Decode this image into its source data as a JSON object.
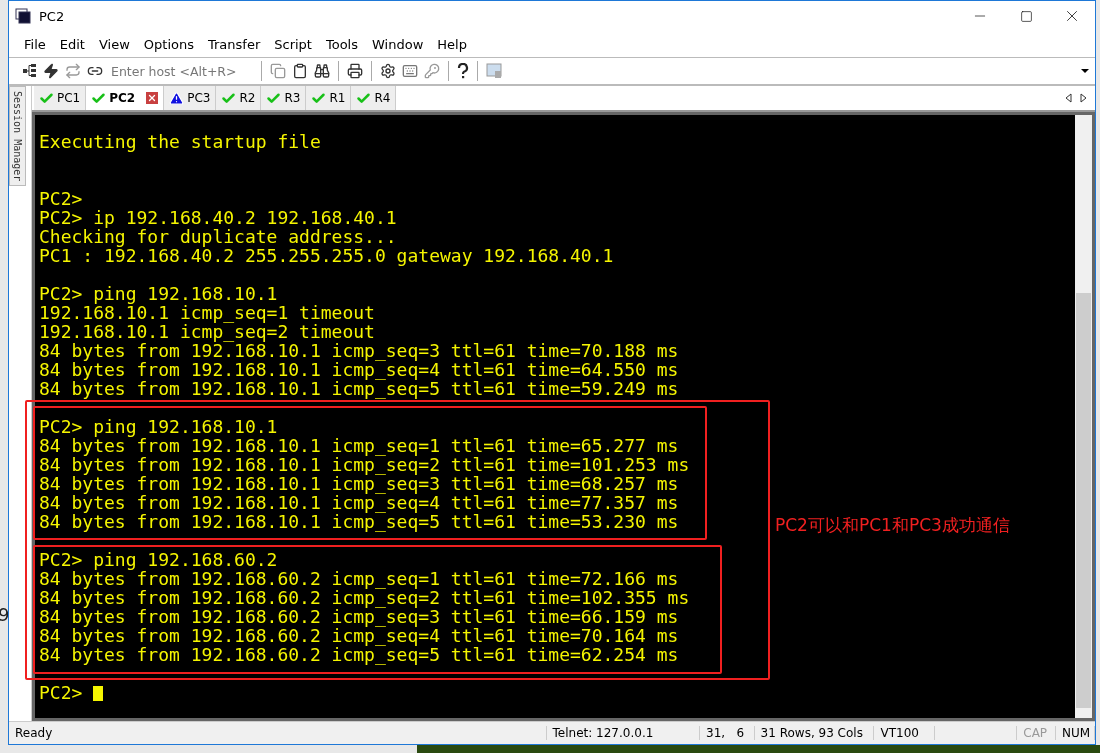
{
  "window": {
    "title": "PC2"
  },
  "menu": [
    "File",
    "Edit",
    "View",
    "Options",
    "Transfer",
    "Script",
    "Tools",
    "Window",
    "Help"
  ],
  "toolbar": {
    "host_field": {
      "placeholder": "Enter host <Alt+R>"
    }
  },
  "side_tab": {
    "label": "Session Manager"
  },
  "tabs": [
    {
      "label": "PC1",
      "kind": "ok",
      "selected": false
    },
    {
      "label": "PC2",
      "kind": "ok",
      "selected": true
    },
    {
      "label": "PC3",
      "kind": "warn",
      "selected": false
    },
    {
      "label": "R2",
      "kind": "ok",
      "selected": false
    },
    {
      "label": "R3",
      "kind": "ok",
      "selected": false
    },
    {
      "label": "R1",
      "kind": "ok",
      "selected": false
    },
    {
      "label": "R4",
      "kind": "ok",
      "selected": false
    }
  ],
  "terminal": {
    "lines": [
      {
        "kind": "text",
        "text": "Executing the startup file"
      },
      {
        "kind": "blank"
      },
      {
        "kind": "blank"
      },
      {
        "kind": "text",
        "text": "PC2>"
      },
      {
        "kind": "text",
        "text": "PC2> ip 192.168.40.2 192.168.40.1"
      },
      {
        "kind": "text",
        "text": "Checking for duplicate address..."
      },
      {
        "kind": "text",
        "text": "PC1 : 192.168.40.2 255.255.255.0 gateway 192.168.40.1"
      },
      {
        "kind": "blank"
      },
      {
        "kind": "text",
        "text": "PC2> ping 192.168.10.1"
      },
      {
        "kind": "text",
        "text": "192.168.10.1 icmp_seq=1 timeout"
      },
      {
        "kind": "text",
        "text": "192.168.10.1 icmp_seq=2 timeout"
      },
      {
        "kind": "text",
        "text": "84 bytes from 192.168.10.1 icmp_seq=3 ttl=61 time=70.188 ms"
      },
      {
        "kind": "text",
        "text": "84 bytes from 192.168.10.1 icmp_seq=4 ttl=61 time=64.550 ms"
      },
      {
        "kind": "text",
        "text": "84 bytes from 192.168.10.1 icmp_seq=5 ttl=61 time=59.249 ms"
      },
      {
        "kind": "blank"
      },
      {
        "kind": "text",
        "text": "PC2> ping 192.168.10.1"
      },
      {
        "kind": "text",
        "text": "84 bytes from 192.168.10.1 icmp_seq=1 ttl=61 time=65.277 ms"
      },
      {
        "kind": "text",
        "text": "84 bytes from 192.168.10.1 icmp_seq=2 ttl=61 time=101.253 ms"
      },
      {
        "kind": "text",
        "text": "84 bytes from 192.168.10.1 icmp_seq=3 ttl=61 time=68.257 ms"
      },
      {
        "kind": "text",
        "text": "84 bytes from 192.168.10.1 icmp_seq=4 ttl=61 time=77.357 ms"
      },
      {
        "kind": "text",
        "text": "84 bytes from 192.168.10.1 icmp_seq=5 ttl=61 time=53.230 ms"
      },
      {
        "kind": "blank"
      },
      {
        "kind": "text",
        "text": "PC2> ping 192.168.60.2"
      },
      {
        "kind": "text",
        "text": "84 bytes from 192.168.60.2 icmp_seq=1 ttl=61 time=72.166 ms"
      },
      {
        "kind": "text",
        "text": "84 bytes from 192.168.60.2 icmp_seq=2 ttl=61 time=102.355 ms"
      },
      {
        "kind": "text",
        "text": "84 bytes from 192.168.60.2 icmp_seq=3 ttl=61 time=66.159 ms"
      },
      {
        "kind": "text",
        "text": "84 bytes from 192.168.60.2 icmp_seq=4 ttl=61 time=70.164 ms"
      },
      {
        "kind": "text",
        "text": "84 bytes from 192.168.60.2 icmp_seq=5 ttl=61 time=62.254 ms"
      },
      {
        "kind": "blank"
      },
      {
        "kind": "prompt",
        "text": "PC2>",
        "cursor": true
      }
    ],
    "annotation": "PC2可以和PC1和PC3成功通信"
  },
  "status_bar": {
    "message": "Ready",
    "connection": "Telnet: 127.0.0.1",
    "position": "31,   6",
    "size": "31 Rows, 93 Cols",
    "emulation": "VT100",
    "indicators": [
      {
        "label": "CAP",
        "on": false
      },
      {
        "label": "NUM",
        "on": true
      }
    ]
  },
  "desktop": {
    "text": "9"
  }
}
